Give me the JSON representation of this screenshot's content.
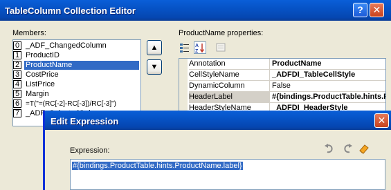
{
  "main_dialog": {
    "title": "TableColumn Collection Editor",
    "members_label": "Members:",
    "members": [
      {
        "index": "0",
        "name": "_ADF_ChangedColumn"
      },
      {
        "index": "1",
        "name": "ProductID"
      },
      {
        "index": "2",
        "name": "ProductName",
        "selected": true
      },
      {
        "index": "3",
        "name": "CostPrice"
      },
      {
        "index": "4",
        "name": "ListPrice"
      },
      {
        "index": "5",
        "name": "Margin"
      },
      {
        "index": "6",
        "name": "=T(\"=(RC[-2]-RC[-3])/RC[-3]\")"
      },
      {
        "index": "7",
        "name": "_ADF_SelectedColumn"
      }
    ],
    "properties_label": "ProductName properties:",
    "properties": [
      {
        "name": "Annotation",
        "value": "ProductName",
        "bold": true
      },
      {
        "name": "CellStyleName",
        "value": "_ADFDI_TableCellStyle",
        "bold": true
      },
      {
        "name": "DynamicColumn",
        "value": "False",
        "bold": false
      },
      {
        "name": "HeaderLabel",
        "value": "#{bindings.ProductTable.hints.ProductName.label}",
        "bold": true,
        "selected": true
      },
      {
        "name": "HeaderStyleName",
        "value": "_ADFDI_HeaderStyle",
        "bold": true
      }
    ],
    "move_up_glyph": "▲",
    "move_down_glyph": "▼",
    "help_glyph": "?",
    "close_glyph": "✕"
  },
  "edit_dialog": {
    "title": "Edit Expression",
    "expression_label": "Expression:",
    "expression_value": "#{bindings.ProductTable.hints.ProductName.label}",
    "close_glyph": "✕"
  },
  "colors": {
    "titlebar": "#0653c6",
    "selection": "#316ac5",
    "dialog_bg": "#ece9d8"
  }
}
